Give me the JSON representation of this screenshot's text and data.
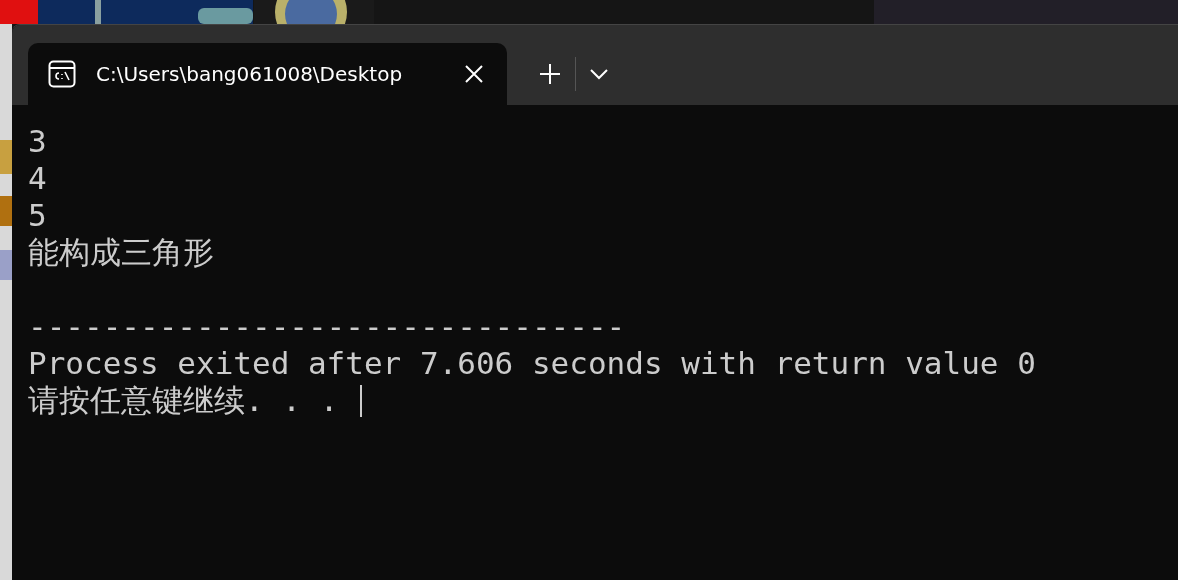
{
  "window": {
    "tabs": [
      {
        "title": "C:\\Users\\bang061008\\Desktop",
        "selected": true
      }
    ]
  },
  "terminal": {
    "output": [
      "3",
      "4",
      "5",
      "能构成三角形"
    ],
    "footer": [
      "--------------------------------",
      "Process exited after 7.606 seconds with return value 0",
      "请按任意键继续. . ."
    ]
  }
}
